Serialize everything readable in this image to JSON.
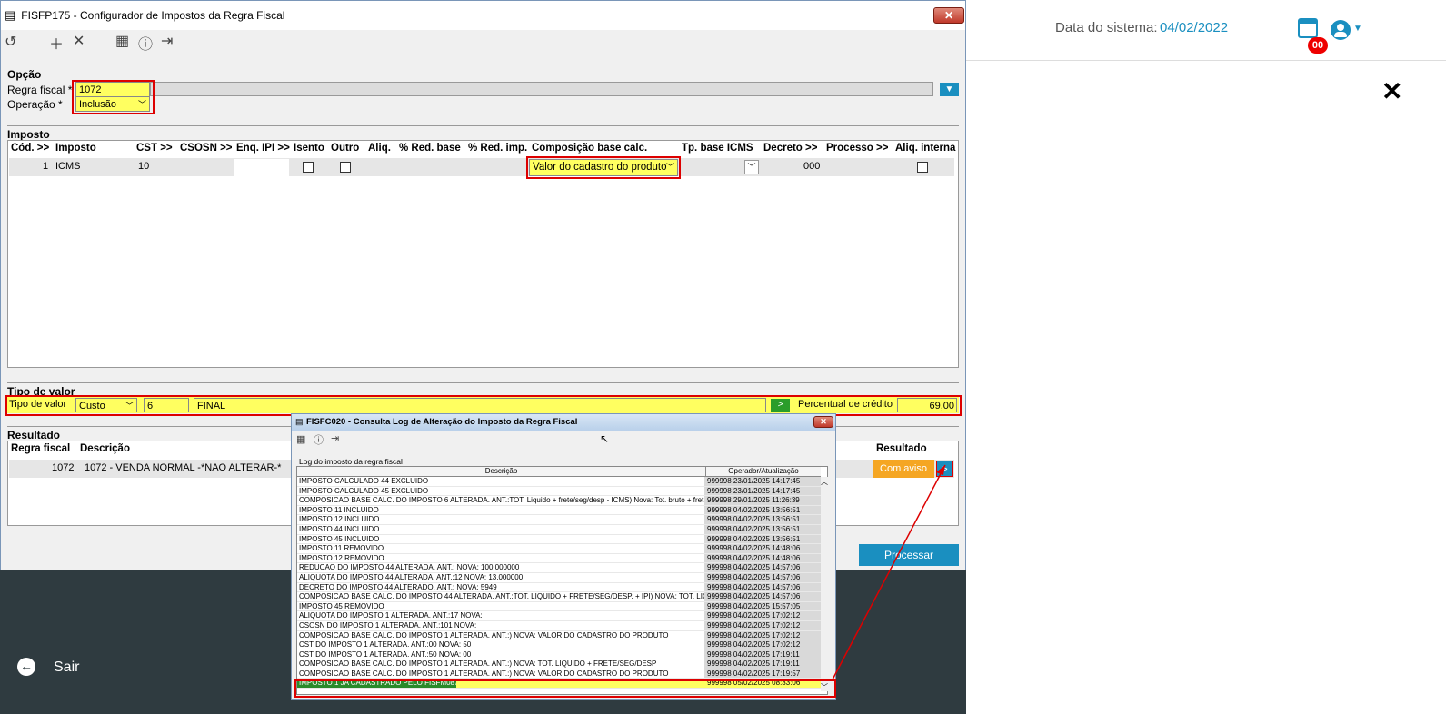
{
  "header": {
    "system_date_label": "Data do sistema:",
    "system_date_value": "04/02/2022",
    "badge": "00",
    "calendar_icon": "calendar-icon",
    "user_icon": "user-circle-icon"
  },
  "main_window": {
    "title": "FISFP175 - Configurador de Impostos da Regra Fiscal",
    "close_label": "✕",
    "opcao": {
      "section": "Opção",
      "regra_label": "Regra fiscal *",
      "regra_value": "1072",
      "operacao_label": "Operação *",
      "operacao_value": "Inclusão"
    },
    "imposto": {
      "section": "Imposto",
      "headers": [
        "Cód. >>",
        "Imposto",
        "CST >>",
        "CSOSN >>",
        "Enq. IPI >>",
        "Isento",
        "Outro",
        "Aliq.",
        "% Red. base",
        "% Red. imp.",
        "Composição base calc.",
        "Tp. base ICMS",
        "Decreto >>",
        "Processo  >>",
        "Aliq. interna"
      ],
      "row": {
        "cod": "1",
        "imposto": "ICMS",
        "cst": "10",
        "composicao": "Valor do cadastro do produto",
        "decreto": "000"
      }
    },
    "tipo_valor": {
      "section": "Tipo de valor",
      "label": "Tipo de valor",
      "tipo": "Custo",
      "codigo": "6",
      "descricao": "FINAL",
      "percentual_label": "Percentual de crédito",
      "percentual_value": "69,00"
    },
    "resultado": {
      "section": "Resultado",
      "headers": [
        "Regra fiscal",
        "Descrição",
        "Resultado"
      ],
      "row": {
        "regra": "1072",
        "descricao": "1072 - VENDA NORMAL -*NAO ALTERAR-*",
        "resultado": "Com aviso",
        "go": ">"
      }
    },
    "processar_label": "Processar"
  },
  "sair_label": "Sair",
  "log_window": {
    "title": "FISFC020 - Consulta Log de Alteração do Imposto da Regra Fiscal",
    "close_label": "✕",
    "group_label": "Log do imposto da regra fiscal",
    "col_desc": "Descrição",
    "col_oper": "Operador/Atualização",
    "rows": [
      {
        "d": "IMPOSTO CALCULADO 44 EXCLUIDO",
        "o": "999998  23/01/2025  14:17:45"
      },
      {
        "d": "IMPOSTO CALCULADO 45 EXCLUIDO",
        "o": "999998  23/01/2025  14:17:45"
      },
      {
        "d": "COMPOSICAO BASE CALC. DO IMPOSTO 6 ALTERADA. ANT.:TOT. Liquido + frete/seg/desp - ICMS) Nova: Tot. bruto + fret",
        "o": "999998  29/01/2025  11:26:39"
      },
      {
        "d": "IMPOSTO 11 INCLUIDO",
        "o": "999998  04/02/2025  13:56:51"
      },
      {
        "d": "IMPOSTO 12 INCLUIDO",
        "o": "999998  04/02/2025  13:56:51"
      },
      {
        "d": "IMPOSTO 44 INCLUIDO",
        "o": "999998  04/02/2025  13:56:51"
      },
      {
        "d": "IMPOSTO 45 INCLUIDO",
        "o": "999998  04/02/2025  13:56:51"
      },
      {
        "d": "IMPOSTO 11 REMOVIDO",
        "o": "999998  04/02/2025  14:48:06"
      },
      {
        "d": "IMPOSTO 12 REMOVIDO",
        "o": "999998  04/02/2025  14:48:06"
      },
      {
        "d": "REDUCAO DO IMPOSTO 44 ALTERADA. ANT.: NOVA: 100,000000",
        "o": "999998  04/02/2025  14:57:06"
      },
      {
        "d": "ALIQUOTA DO IMPOSTO 44 ALTERADA. ANT.:12 NOVA: 13,000000",
        "o": "999998  04/02/2025  14:57:06"
      },
      {
        "d": "DECRETO DO IMPOSTO 44 ALTERADO. ANT.: NOVA: 5949",
        "o": "999998  04/02/2025  14:57:06"
      },
      {
        "d": "COMPOSICAO BASE CALC. DO IMPOSTO 44 ALTERADA. ANT.:TOT. LIQUIDO + FRETE/SEG/DESP. + IPI) NOVA: TOT. LIQUE",
        "o": "999998  04/02/2025  14:57:06"
      },
      {
        "d": "IMPOSTO 45 REMOVIDO",
        "o": "999998  04/02/2025  15:57:05"
      },
      {
        "d": "ALIQUOTA DO IMPOSTO 1 ALTERADA. ANT.:17 NOVA:",
        "o": "999998  04/02/2025  17:02:12"
      },
      {
        "d": "CSOSN DO IMPOSTO 1 ALTERADA. ANT.:101 NOVA:",
        "o": "999998  04/02/2025  17:02:12"
      },
      {
        "d": "COMPOSICAO BASE CALC. DO IMPOSTO 1 ALTERADA. ANT.:) NOVA: VALOR DO CADASTRO DO PRODUTO",
        "o": "999998  04/02/2025  17:02:12"
      },
      {
        "d": "CST DO IMPOSTO 1 ALTERADA. ANT.:00 NOVA: 50",
        "o": "999998  04/02/2025  17:02:12"
      },
      {
        "d": "CST DO IMPOSTO 1 ALTERADA. ANT.:50 NOVA: 00",
        "o": "999998  04/02/2025  17:19:11"
      },
      {
        "d": "COMPOSICAO BASE CALC. DO IMPOSTO 1 ALTERADA. ANT.:) NOVA: TOT. LIQUIDO + FRETE/SEG/DESP",
        "o": "999998  04/02/2025  17:19:11"
      },
      {
        "d": "COMPOSICAO BASE CALC. DO IMPOSTO 1 ALTERADA. ANT.:) NOVA: VALOR DO CADASTRO DO PRODUTO",
        "o": "999998  04/02/2025  17:19:57"
      },
      {
        "d": "IMPOSTO 1 JA CADASTRADO PELO FISFM087",
        "o": "999998  05/02/2025  08:33:06"
      }
    ]
  },
  "colors": {
    "accent": "#1a8fc0",
    "highlight": "#ffff60",
    "warning": "#f5a623",
    "annotation": "#d00000"
  }
}
